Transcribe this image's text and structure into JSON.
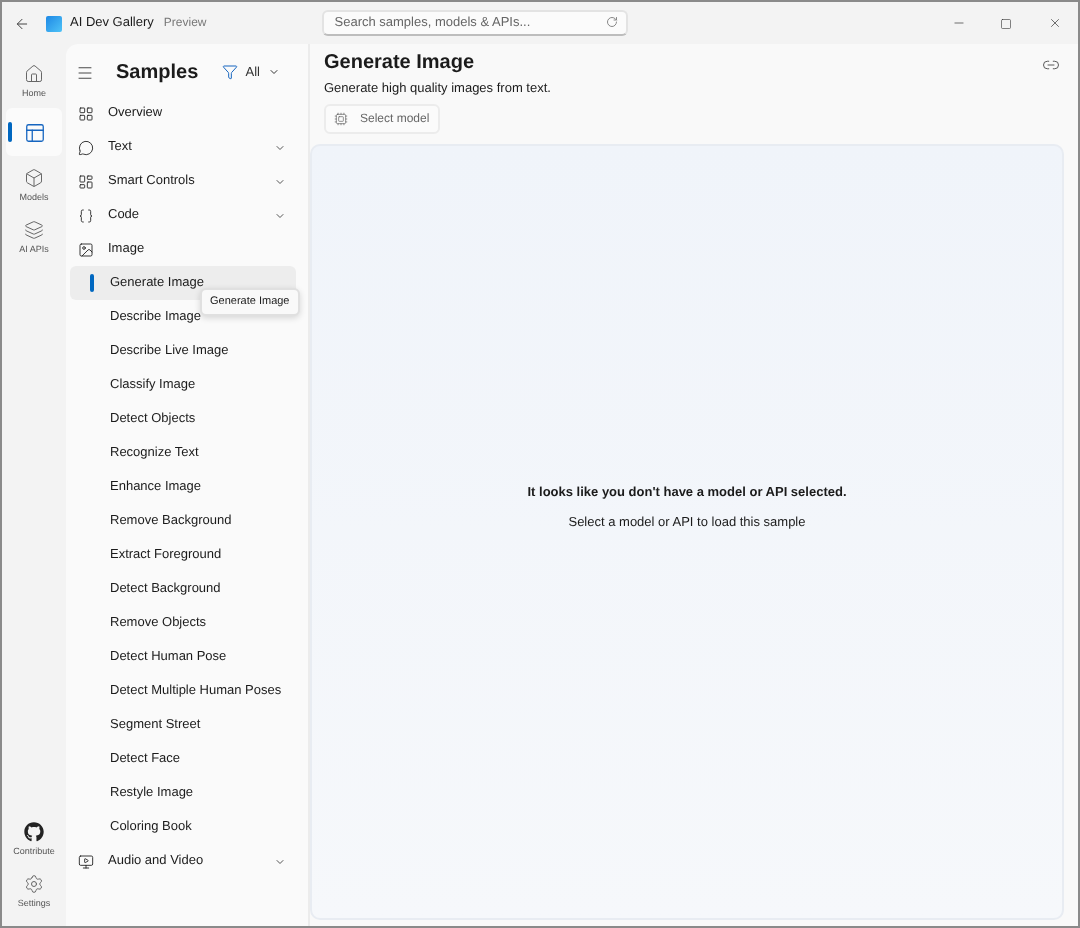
{
  "window": {
    "app_name": "AI Dev Gallery",
    "badge": "Preview",
    "search": {
      "placeholder": "Search samples, models & APIs..."
    }
  },
  "nav_rail": {
    "top": [
      {
        "kind": "home",
        "label": "Home",
        "selected": false
      },
      {
        "kind": "samples",
        "selected": true
      },
      {
        "kind": "models",
        "label": "Models",
        "selected": false
      },
      {
        "kind": "apis",
        "label": "AI APIs",
        "selected": false
      }
    ],
    "bottom": [
      {
        "kind": "github",
        "label": "Contribute",
        "selected": false
      },
      {
        "kind": "settings",
        "label": "Settings",
        "selected": false
      }
    ]
  },
  "sidebar": {
    "title": "Samples",
    "filter": "All",
    "items": [
      {
        "kind": "overview",
        "label": "Overview",
        "selected": false
      },
      {
        "kind": "text",
        "label": "Text",
        "expanded": false,
        "selected": false
      },
      {
        "kind": "controls",
        "label": "Smart Controls",
        "expanded": false,
        "selected": false
      },
      {
        "kind": "code",
        "label": "Code",
        "expanded": false,
        "selected": false
      },
      {
        "kind": "image",
        "label": "Image",
        "expanded": true,
        "selected": false,
        "children": [
          {
            "label": "Generate Image",
            "selected": true
          },
          {
            "label": "Describe Image",
            "selected": false
          },
          {
            "label": "Describe Live Image",
            "selected": false
          },
          {
            "label": "Classify Image",
            "selected": false
          },
          {
            "label": "Detect Objects",
            "selected": false
          },
          {
            "label": "Recognize Text",
            "selected": false
          },
          {
            "label": "Enhance Image",
            "selected": false
          },
          {
            "label": "Remove Background",
            "selected": false
          },
          {
            "label": "Extract Foreground",
            "selected": false
          },
          {
            "label": "Detect Background",
            "selected": false
          },
          {
            "label": "Remove Objects",
            "selected": false
          },
          {
            "label": "Detect Human Pose",
            "selected": false
          },
          {
            "label": "Detect Multiple Human Poses",
            "selected": false
          },
          {
            "label": "Segment Street",
            "selected": false
          },
          {
            "label": "Detect Face",
            "selected": false
          },
          {
            "label": "Restyle Image",
            "selected": false
          },
          {
            "label": "Coloring Book",
            "selected": false
          }
        ]
      },
      {
        "kind": "av",
        "label": "Audio and Video",
        "expanded": false,
        "selected": false
      }
    ],
    "tooltip": "Generate Image"
  },
  "main": {
    "title": "Generate Image",
    "subtitle": "Generate high quality images from text.",
    "select_model": "Select model",
    "message": "It looks like you don't have a model or API selected.",
    "hint": "Select a model or API to load this sample"
  }
}
